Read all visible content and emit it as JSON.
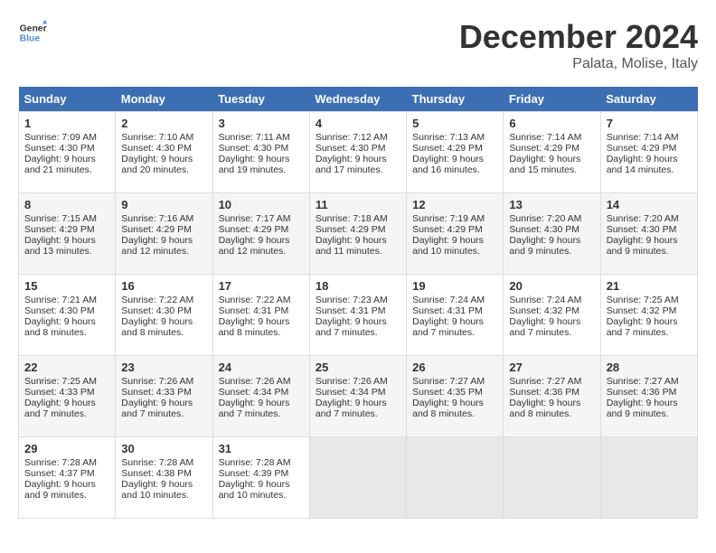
{
  "header": {
    "logo_line1": "General",
    "logo_line2": "Blue",
    "month_title": "December 2024",
    "location": "Palata, Molise, Italy"
  },
  "days_of_week": [
    "Sunday",
    "Monday",
    "Tuesday",
    "Wednesday",
    "Thursday",
    "Friday",
    "Saturday"
  ],
  "weeks": [
    [
      {
        "day": "1",
        "sunrise": "Sunrise: 7:09 AM",
        "sunset": "Sunset: 4:30 PM",
        "daylight": "Daylight: 9 hours and 21 minutes."
      },
      {
        "day": "2",
        "sunrise": "Sunrise: 7:10 AM",
        "sunset": "Sunset: 4:30 PM",
        "daylight": "Daylight: 9 hours and 20 minutes."
      },
      {
        "day": "3",
        "sunrise": "Sunrise: 7:11 AM",
        "sunset": "Sunset: 4:30 PM",
        "daylight": "Daylight: 9 hours and 19 minutes."
      },
      {
        "day": "4",
        "sunrise": "Sunrise: 7:12 AM",
        "sunset": "Sunset: 4:30 PM",
        "daylight": "Daylight: 9 hours and 17 minutes."
      },
      {
        "day": "5",
        "sunrise": "Sunrise: 7:13 AM",
        "sunset": "Sunset: 4:29 PM",
        "daylight": "Daylight: 9 hours and 16 minutes."
      },
      {
        "day": "6",
        "sunrise": "Sunrise: 7:14 AM",
        "sunset": "Sunset: 4:29 PM",
        "daylight": "Daylight: 9 hours and 15 minutes."
      },
      {
        "day": "7",
        "sunrise": "Sunrise: 7:14 AM",
        "sunset": "Sunset: 4:29 PM",
        "daylight": "Daylight: 9 hours and 14 minutes."
      }
    ],
    [
      {
        "day": "8",
        "sunrise": "Sunrise: 7:15 AM",
        "sunset": "Sunset: 4:29 PM",
        "daylight": "Daylight: 9 hours and 13 minutes."
      },
      {
        "day": "9",
        "sunrise": "Sunrise: 7:16 AM",
        "sunset": "Sunset: 4:29 PM",
        "daylight": "Daylight: 9 hours and 12 minutes."
      },
      {
        "day": "10",
        "sunrise": "Sunrise: 7:17 AM",
        "sunset": "Sunset: 4:29 PM",
        "daylight": "Daylight: 9 hours and 12 minutes."
      },
      {
        "day": "11",
        "sunrise": "Sunrise: 7:18 AM",
        "sunset": "Sunset: 4:29 PM",
        "daylight": "Daylight: 9 hours and 11 minutes."
      },
      {
        "day": "12",
        "sunrise": "Sunrise: 7:19 AM",
        "sunset": "Sunset: 4:29 PM",
        "daylight": "Daylight: 9 hours and 10 minutes."
      },
      {
        "day": "13",
        "sunrise": "Sunrise: 7:20 AM",
        "sunset": "Sunset: 4:30 PM",
        "daylight": "Daylight: 9 hours and 9 minutes."
      },
      {
        "day": "14",
        "sunrise": "Sunrise: 7:20 AM",
        "sunset": "Sunset: 4:30 PM",
        "daylight": "Daylight: 9 hours and 9 minutes."
      }
    ],
    [
      {
        "day": "15",
        "sunrise": "Sunrise: 7:21 AM",
        "sunset": "Sunset: 4:30 PM",
        "daylight": "Daylight: 9 hours and 8 minutes."
      },
      {
        "day": "16",
        "sunrise": "Sunrise: 7:22 AM",
        "sunset": "Sunset: 4:30 PM",
        "daylight": "Daylight: 9 hours and 8 minutes."
      },
      {
        "day": "17",
        "sunrise": "Sunrise: 7:22 AM",
        "sunset": "Sunset: 4:31 PM",
        "daylight": "Daylight: 9 hours and 8 minutes."
      },
      {
        "day": "18",
        "sunrise": "Sunrise: 7:23 AM",
        "sunset": "Sunset: 4:31 PM",
        "daylight": "Daylight: 9 hours and 7 minutes."
      },
      {
        "day": "19",
        "sunrise": "Sunrise: 7:24 AM",
        "sunset": "Sunset: 4:31 PM",
        "daylight": "Daylight: 9 hours and 7 minutes."
      },
      {
        "day": "20",
        "sunrise": "Sunrise: 7:24 AM",
        "sunset": "Sunset: 4:32 PM",
        "daylight": "Daylight: 9 hours and 7 minutes."
      },
      {
        "day": "21",
        "sunrise": "Sunrise: 7:25 AM",
        "sunset": "Sunset: 4:32 PM",
        "daylight": "Daylight: 9 hours and 7 minutes."
      }
    ],
    [
      {
        "day": "22",
        "sunrise": "Sunrise: 7:25 AM",
        "sunset": "Sunset: 4:33 PM",
        "daylight": "Daylight: 9 hours and 7 minutes."
      },
      {
        "day": "23",
        "sunrise": "Sunrise: 7:26 AM",
        "sunset": "Sunset: 4:33 PM",
        "daylight": "Daylight: 9 hours and 7 minutes."
      },
      {
        "day": "24",
        "sunrise": "Sunrise: 7:26 AM",
        "sunset": "Sunset: 4:34 PM",
        "daylight": "Daylight: 9 hours and 7 minutes."
      },
      {
        "day": "25",
        "sunrise": "Sunrise: 7:26 AM",
        "sunset": "Sunset: 4:34 PM",
        "daylight": "Daylight: 9 hours and 7 minutes."
      },
      {
        "day": "26",
        "sunrise": "Sunrise: 7:27 AM",
        "sunset": "Sunset: 4:35 PM",
        "daylight": "Daylight: 9 hours and 8 minutes."
      },
      {
        "day": "27",
        "sunrise": "Sunrise: 7:27 AM",
        "sunset": "Sunset: 4:36 PM",
        "daylight": "Daylight: 9 hours and 8 minutes."
      },
      {
        "day": "28",
        "sunrise": "Sunrise: 7:27 AM",
        "sunset": "Sunset: 4:36 PM",
        "daylight": "Daylight: 9 hours and 9 minutes."
      }
    ],
    [
      {
        "day": "29",
        "sunrise": "Sunrise: 7:28 AM",
        "sunset": "Sunset: 4:37 PM",
        "daylight": "Daylight: 9 hours and 9 minutes."
      },
      {
        "day": "30",
        "sunrise": "Sunrise: 7:28 AM",
        "sunset": "Sunset: 4:38 PM",
        "daylight": "Daylight: 9 hours and 10 minutes."
      },
      {
        "day": "31",
        "sunrise": "Sunrise: 7:28 AM",
        "sunset": "Sunset: 4:39 PM",
        "daylight": "Daylight: 9 hours and 10 minutes."
      },
      null,
      null,
      null,
      null
    ]
  ]
}
